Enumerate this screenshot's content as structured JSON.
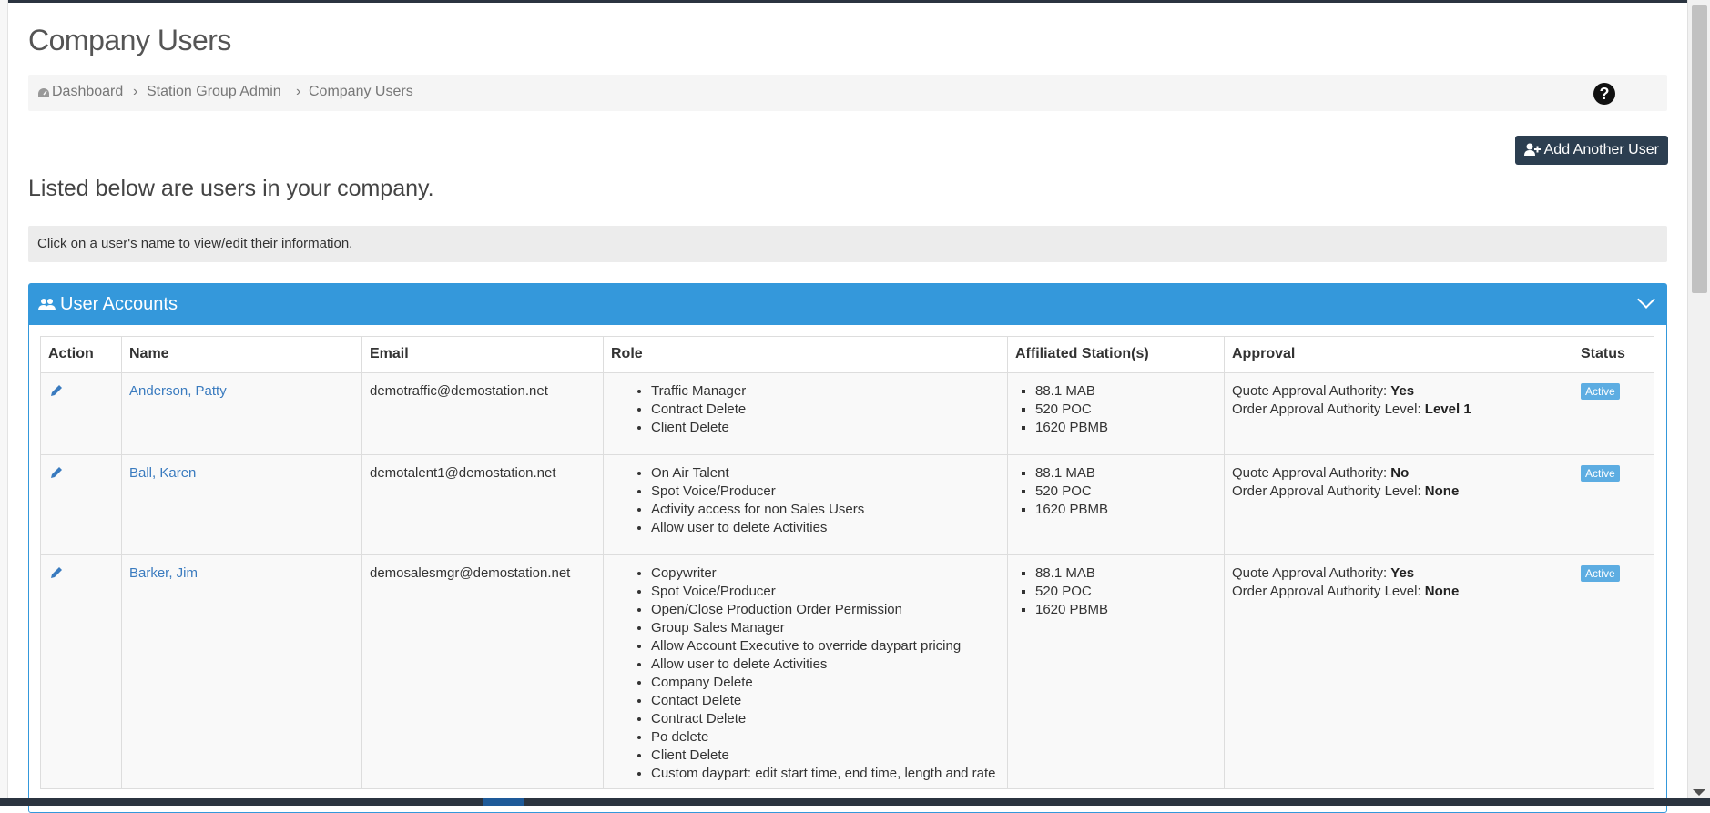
{
  "page": {
    "title": "Company Users",
    "intro": "Listed below are users in your company.",
    "info": "Click on a user's name to view/edit their information.",
    "add_button": "Add Another User"
  },
  "breadcrumb": {
    "items": [
      "Dashboard",
      "Station Group Admin",
      "Company Users"
    ],
    "separator": "›"
  },
  "panel": {
    "title": "User Accounts"
  },
  "table": {
    "headers": [
      "Action",
      "Name",
      "Email",
      "Role",
      "Affiliated Station(s)",
      "Approval",
      "Status"
    ],
    "rows": [
      {
        "name": "Anderson, Patty",
        "email": "demotraffic@demostation.net",
        "roles": [
          "Traffic Manager",
          "Contract Delete",
          "Client Delete"
        ],
        "stations": [
          "88.1 MAB",
          "520 POC",
          "1620 PBMB"
        ],
        "quote_label": "Quote Approval Authority:",
        "quote_value": "Yes",
        "order_label": "Order Approval Authority Level:",
        "order_value": "Level 1",
        "status": "Active"
      },
      {
        "name": "Ball, Karen",
        "email": "demotalent1@demostation.net",
        "roles": [
          "On Air Talent",
          "Spot Voice/Producer",
          "Activity access for non Sales Users",
          "Allow user to delete Activities"
        ],
        "stations": [
          "88.1 MAB",
          "520 POC",
          "1620 PBMB"
        ],
        "quote_label": "Quote Approval Authority:",
        "quote_value": "No",
        "order_label": "Order Approval Authority Level:",
        "order_value": "None",
        "status": "Active"
      },
      {
        "name": "Barker, Jim",
        "email": "demosalesmgr@demostation.net",
        "roles": [
          "Copywriter",
          "Spot Voice/Producer",
          "Open/Close Production Order Permission",
          "Group Sales Manager",
          "Allow Account Executive to override daypart pricing",
          "Allow user to delete Activities",
          "Company Delete",
          "Contact Delete",
          "Contract Delete",
          "Po delete",
          "Client Delete",
          "Custom daypart: edit start time, end time, length and rate"
        ],
        "stations": [
          "88.1 MAB",
          "520 POC",
          "1620 PBMB"
        ],
        "quote_label": "Quote Approval Authority:",
        "quote_value": "Yes",
        "order_label": "Order Approval Authority Level:",
        "order_value": "None",
        "status": "Active"
      }
    ]
  },
  "colors": {
    "panel": "#3498db",
    "button": "#2c3e50",
    "link": "#3a7bbf",
    "badge": "#5dade2"
  },
  "icons": [
    "dashboard-icon",
    "help-icon",
    "user-plus-icon",
    "users-icon",
    "chevron-down-icon",
    "pencil-icon"
  ]
}
